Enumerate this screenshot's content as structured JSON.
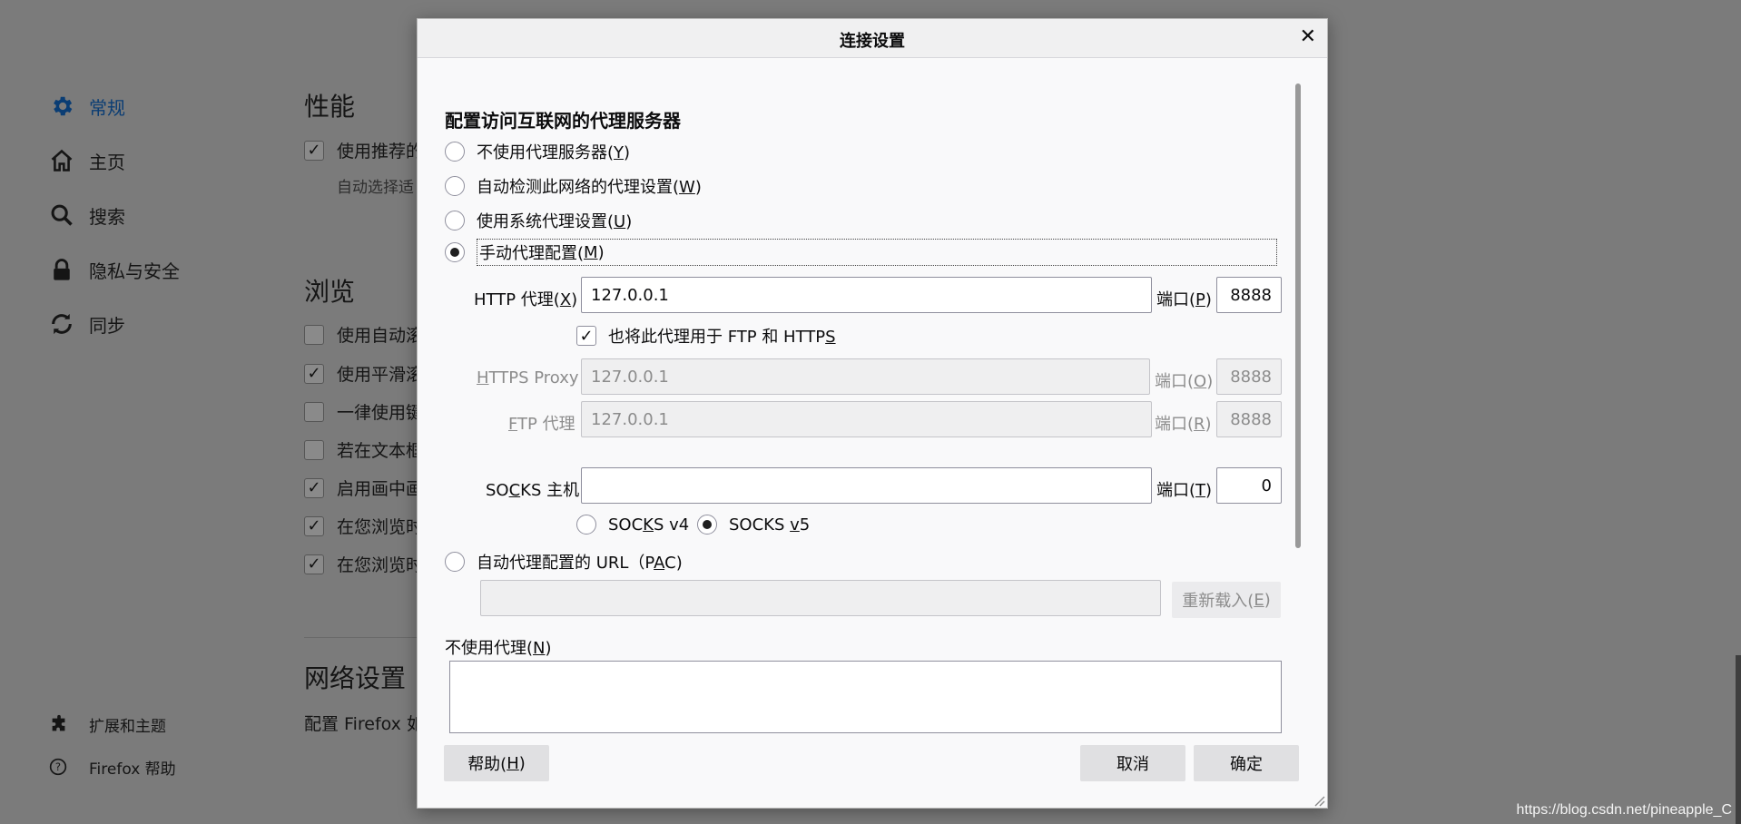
{
  "sidebar": {
    "items": [
      {
        "label": "常规",
        "icon": "gear-icon"
      },
      {
        "label": "主页",
        "icon": "home-icon"
      },
      {
        "label": "搜索",
        "icon": "search-icon"
      },
      {
        "label": "隐私与安全",
        "icon": "lock-icon"
      },
      {
        "label": "同步",
        "icon": "sync-icon"
      }
    ],
    "bottom": [
      {
        "label": "扩展和主题",
        "icon": "puzzle-icon"
      },
      {
        "label": "Firefox 帮助",
        "icon": "help-icon"
      }
    ]
  },
  "main": {
    "performance_title": "性能",
    "performance_option": "使用推荐的",
    "performance_sub": "自动选择适",
    "browsing_title": "浏览",
    "browsing_options": [
      "使用自动滚",
      "使用平滑滚",
      "一律使用键",
      "若在文本框",
      "启用画中画",
      "在您浏览时",
      "在您浏览时"
    ],
    "network_title": "网络设置",
    "network_desc": "配置 Firefox 如"
  },
  "dialog": {
    "title": "连接设置",
    "section_title": "配置访问互联网的代理服务器",
    "radio_no_proxy": {
      "text": "不使用代理服务器(",
      "key": "Y",
      "end": ")"
    },
    "radio_auto_detect": {
      "text": "自动检测此网络的代理设置(",
      "key": "W",
      "end": ")"
    },
    "radio_system": {
      "text": "使用系统代理设置(",
      "key": "U",
      "end": ")"
    },
    "radio_manual": {
      "text": "手动代理配置(",
      "key": "M",
      "end": ")"
    },
    "http": {
      "pre": "HTTP 代理(",
      "key": "X",
      "end": ")",
      "value": "127.0.0.1",
      "port_pre": "端口(",
      "port_key": "P",
      "port_end": ")",
      "port": "8888"
    },
    "also_use": {
      "text": "也将此代理用于 FTP 和 HTTP",
      "key": "S"
    },
    "https": {
      "key": "H",
      "rest": "TTPS Proxy",
      "value": "127.0.0.1",
      "port_pre": "端口(",
      "port_key": "O",
      "port_end": ")",
      "port": "8888"
    },
    "ftp": {
      "key": "F",
      "rest": "TP 代理",
      "value": "127.0.0.1",
      "port_pre": "端口(",
      "port_key": "R",
      "port_end": ")",
      "port": "8888"
    },
    "socks": {
      "pre": "SO",
      "key": "C",
      "rest": "KS 主机",
      "value": "",
      "port_pre": "端口(",
      "port_key": "T",
      "port_end": ")",
      "port": "0"
    },
    "socks_v4": {
      "pre": "SOC",
      "key": "K",
      "rest": "S v4"
    },
    "socks_v5": {
      "pre": "SOCKS ",
      "key": "v",
      "rest": "5"
    },
    "radio_pac": {
      "text": "自动代理配置的 URL（P",
      "key": "A",
      "end": "C)"
    },
    "pac_value": "",
    "reload": {
      "text": "重新载入(",
      "key": "E",
      "end": ")"
    },
    "no_proxy": {
      "text": "不使用代理(",
      "key": "N",
      "end": ")"
    },
    "no_proxy_value": "",
    "help": {
      "text": "帮助(",
      "key": "H",
      "end": ")"
    },
    "cancel": "取消",
    "ok": "确定"
  },
  "watermark": "https://blog.csdn.net/pineapple_C"
}
